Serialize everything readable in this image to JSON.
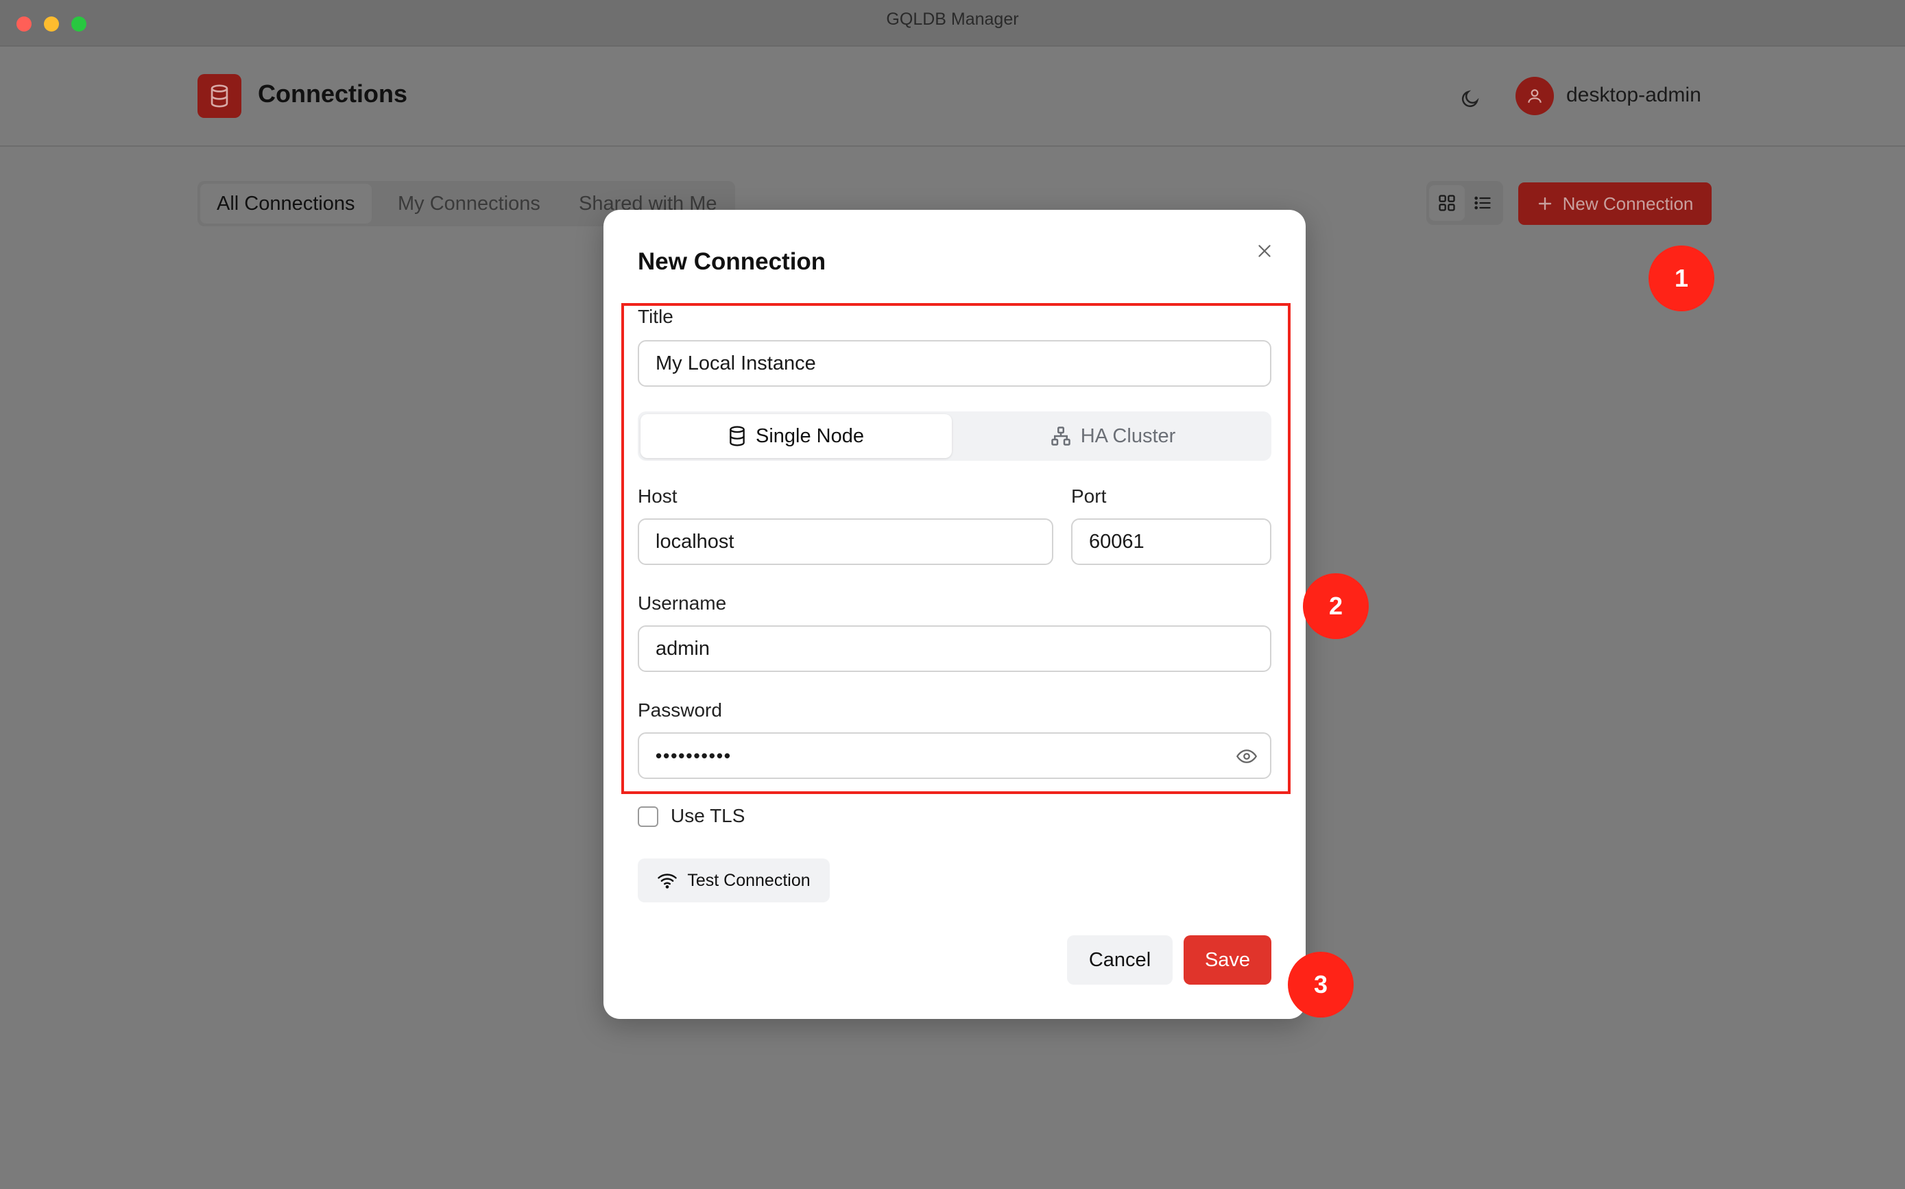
{
  "window": {
    "title": "GQLDB Manager"
  },
  "header": {
    "logo_icon": "database-icon",
    "title": "Connections",
    "theme_icon": "moon-icon",
    "user": {
      "avatar_icon": "user-icon",
      "name": "desktop-admin"
    }
  },
  "toolbar": {
    "tabs": [
      {
        "label": "All Connections",
        "active": true
      },
      {
        "label": "My Connections",
        "active": false
      },
      {
        "label": "Shared with Me",
        "active": false
      }
    ],
    "view_modes": [
      "grid-view-icon",
      "list-view-icon"
    ],
    "new_connection_label": "New Connection"
  },
  "modal": {
    "title": "New Connection",
    "title_field": {
      "label": "Title",
      "value": "My Local Instance"
    },
    "mode_segment": {
      "options": [
        {
          "label": "Single Node",
          "icon": "database-icon",
          "selected": true
        },
        {
          "label": "HA Cluster",
          "icon": "cluster-icon",
          "selected": false
        }
      ]
    },
    "host": {
      "label": "Host",
      "value": "localhost"
    },
    "port": {
      "label": "Port",
      "value": "60061"
    },
    "username": {
      "label": "Username",
      "value": "admin"
    },
    "password": {
      "label": "Password",
      "masked_value": "••••••••••"
    },
    "use_tls": {
      "label": "Use TLS",
      "checked": false
    },
    "test_connection_label": "Test Connection",
    "cancel_label": "Cancel",
    "save_label": "Save"
  },
  "annotations": {
    "steps": [
      "1",
      "2",
      "3"
    ],
    "highlight_color": "#f0231b",
    "badge_color": "#ff2317"
  },
  "colors": {
    "brand_red": "#e0342b",
    "brand_red_dimmed": "#8e1c17"
  }
}
